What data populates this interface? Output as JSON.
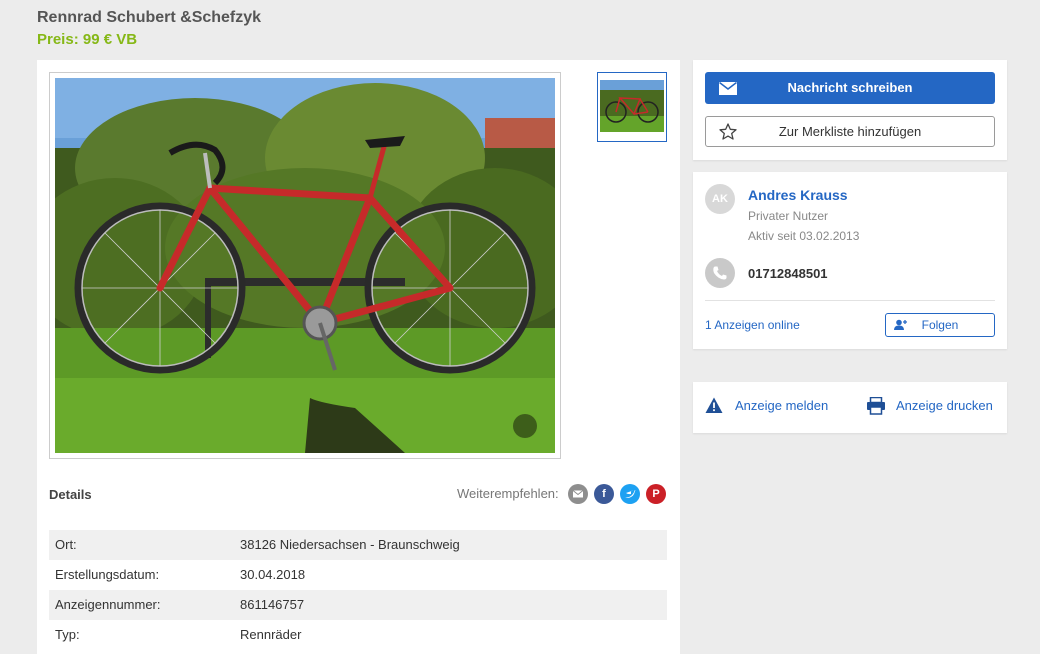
{
  "listing": {
    "title": "Rennrad Schubert &Schefzyk",
    "price": "Preis: 99 € VB"
  },
  "details": {
    "heading": "Details",
    "share_label": "Weiterempfehlen:",
    "rows": [
      {
        "key": "Ort:",
        "value": "38126 Niedersachsen - Braunschweig"
      },
      {
        "key": "Erstellungsdatum:",
        "value": "30.04.2018"
      },
      {
        "key": "Anzeigennummer:",
        "value": "861146757"
      },
      {
        "key": "Typ:",
        "value": "Rennräder"
      }
    ]
  },
  "actions": {
    "message_label": "Nachricht schreiben",
    "watchlist_label": "Zur Merkliste hinzufügen"
  },
  "seller": {
    "initials": "AK",
    "name": "Andres Krauss",
    "type": "Privater Nutzer",
    "active_since": "Aktiv seit 03.02.2013",
    "phone": "01712848501",
    "ads_online": "1 Anzeigen online",
    "follow_label": "Folgen"
  },
  "report": {
    "report_label": "Anzeige melden",
    "print_label": "Anzeige drucken"
  },
  "colors": {
    "accent": "#2467c4",
    "price": "#86b817",
    "background": "#ececec"
  },
  "icons": {
    "message": "envelope-icon",
    "watchlist": "star-icon",
    "phone": "phone-icon",
    "follow": "add-user-icon",
    "report": "warning-icon",
    "print": "printer-icon",
    "share": [
      "mail-icon",
      "facebook-icon",
      "twitter-icon",
      "pinterest-icon"
    ]
  }
}
